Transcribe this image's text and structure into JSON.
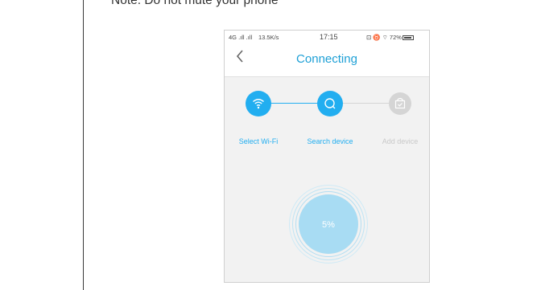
{
  "note": "Note: Do not mute your phone",
  "status_bar": {
    "signal": "4G .ıll .ıll",
    "speed": "13.5K/s",
    "time": "17:15",
    "right": "⊡ ♉ ⌔ 72%"
  },
  "nav": {
    "back_icon": "chevron-left-icon",
    "title": "Connecting"
  },
  "steps": [
    {
      "label": "Select Wi-Fi",
      "icon": "wifi-icon",
      "state": "active"
    },
    {
      "label": "Search device",
      "icon": "search-icon",
      "state": "active"
    },
    {
      "label": "Add device",
      "icon": "bag-check-icon",
      "state": "inactive"
    }
  ],
  "progress": {
    "value": 5,
    "label": "5%"
  },
  "colors": {
    "accent": "#1ea0d6",
    "step_active": "#22aef0",
    "step_inactive": "#d5d5d5",
    "progress_fill": "#a8dcf3"
  }
}
